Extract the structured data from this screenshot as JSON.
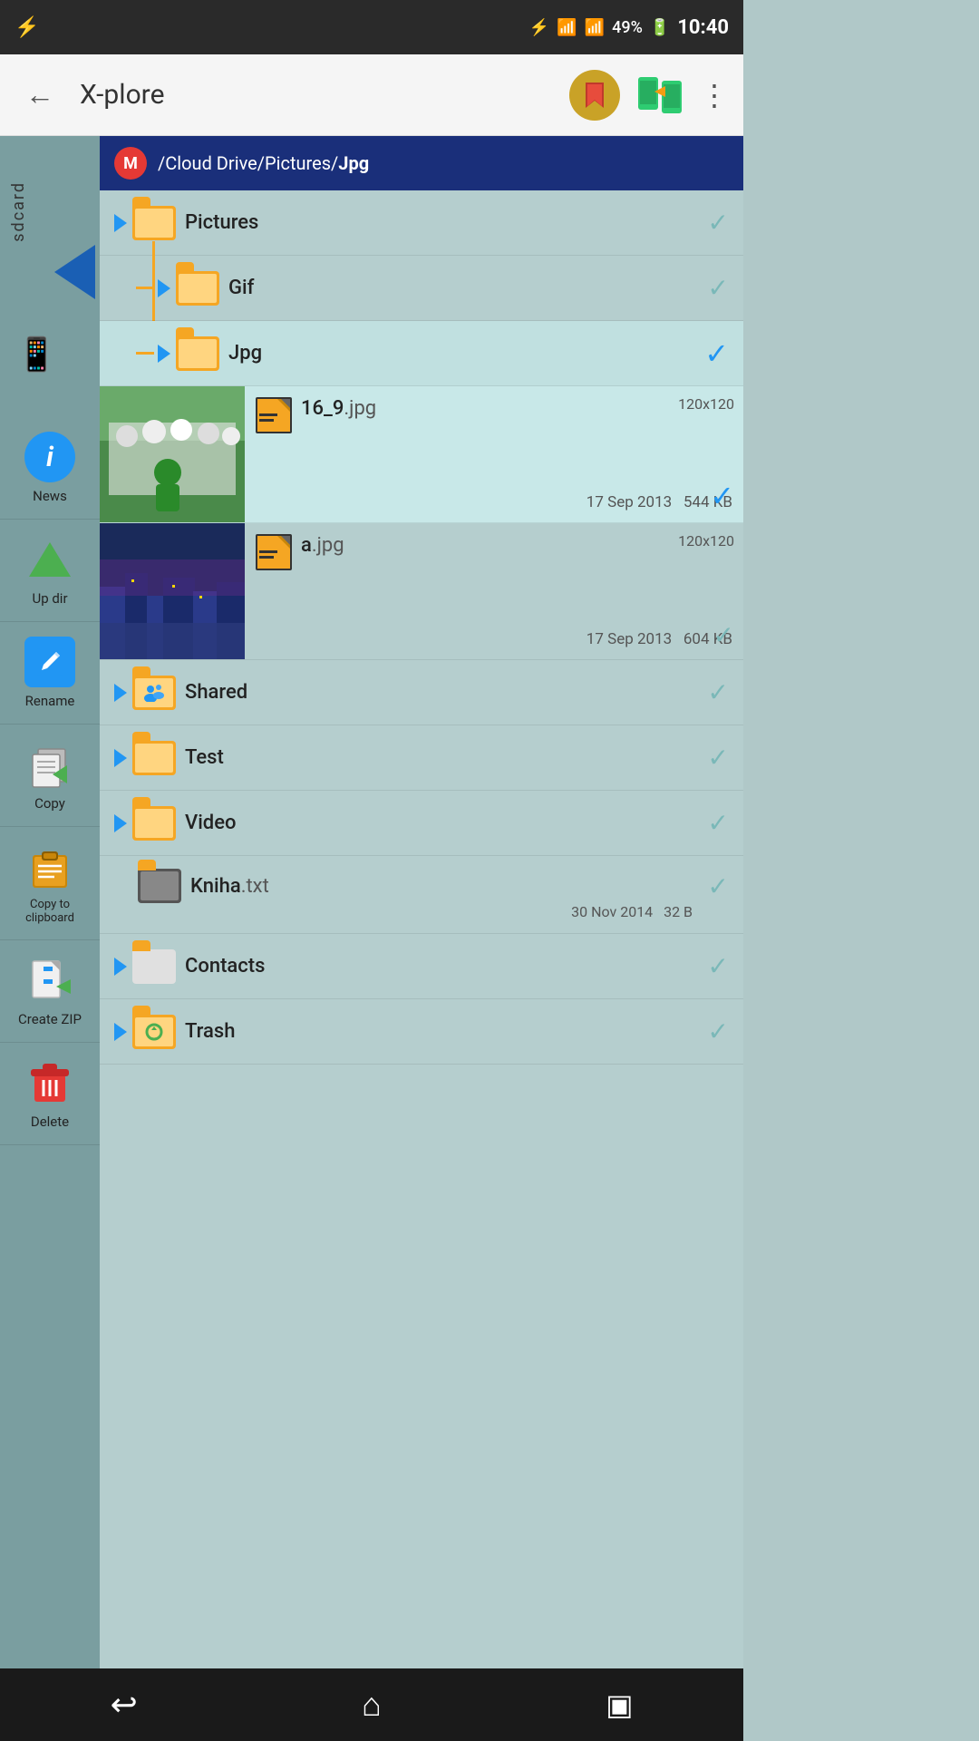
{
  "status_bar": {
    "battery": "49%",
    "time": "10:40",
    "usb_icon": "⚡",
    "bluetooth_icon": "⚡",
    "signal_icon": "📶",
    "wifi_icon": "📶"
  },
  "app_bar": {
    "back_label": "←",
    "title": "X-plore",
    "more_label": "⋮"
  },
  "path_bar": {
    "mega_label": "M",
    "path_prefix": "/Cloud Drive/Pictures/",
    "path_bold": "Jpg"
  },
  "sidebar": {
    "sdcard_label": "sdcard",
    "items": [
      {
        "id": "news",
        "label": "News"
      },
      {
        "id": "updir",
        "label": "Up dir"
      },
      {
        "id": "rename",
        "label": "Rename"
      },
      {
        "id": "copy",
        "label": "Copy"
      },
      {
        "id": "clipboard",
        "label": "Copy to clipboard"
      },
      {
        "id": "createzip",
        "label": "Create ZIP"
      },
      {
        "id": "delete",
        "label": "Delete"
      }
    ]
  },
  "file_list": {
    "items": [
      {
        "id": "pictures",
        "type": "folder",
        "name": "Pictures",
        "indent": 0,
        "expanded": true,
        "checked": true,
        "special": ""
      },
      {
        "id": "gif",
        "type": "folder",
        "name": "Gif",
        "indent": 1,
        "expanded": false,
        "checked": true,
        "special": ""
      },
      {
        "id": "jpg",
        "type": "folder",
        "name": "Jpg",
        "indent": 1,
        "expanded": true,
        "checked": true,
        "special": "",
        "highlighted": true
      },
      {
        "id": "file_16_9",
        "type": "image",
        "name": "16_9",
        "ext": ".jpg",
        "dims": "120x120",
        "date": "17 Sep 2013",
        "size": "544 KB",
        "highlighted": true,
        "checked": true
      },
      {
        "id": "file_a",
        "type": "image",
        "name": "a",
        "ext": ".jpg",
        "dims": "120x120",
        "date": "17 Sep 2013",
        "size": "604 KB",
        "highlighted": false,
        "checked": true
      },
      {
        "id": "shared",
        "type": "folder",
        "name": "Shared",
        "indent": 0,
        "expanded": false,
        "checked": true,
        "special": "shared"
      },
      {
        "id": "test",
        "type": "folder",
        "name": "Test",
        "indent": 0,
        "expanded": false,
        "checked": true,
        "special": ""
      },
      {
        "id": "video",
        "type": "folder",
        "name": "Video",
        "indent": 0,
        "expanded": false,
        "checked": true,
        "special": ""
      },
      {
        "id": "kniha",
        "type": "file",
        "name": "Kniha",
        "ext": ".txt",
        "date": "30 Nov 2014",
        "size": "32 B",
        "special": "dark",
        "checked": true
      },
      {
        "id": "contacts",
        "type": "folder",
        "name": "Contacts",
        "indent": 0,
        "expanded": false,
        "checked": true,
        "special": ""
      },
      {
        "id": "trash",
        "type": "folder",
        "name": "Trash",
        "indent": 0,
        "expanded": false,
        "checked": true,
        "special": "trash"
      }
    ]
  },
  "bottom_nav": {
    "back_label": "↩",
    "home_label": "⌂",
    "recent_label": "▣"
  }
}
